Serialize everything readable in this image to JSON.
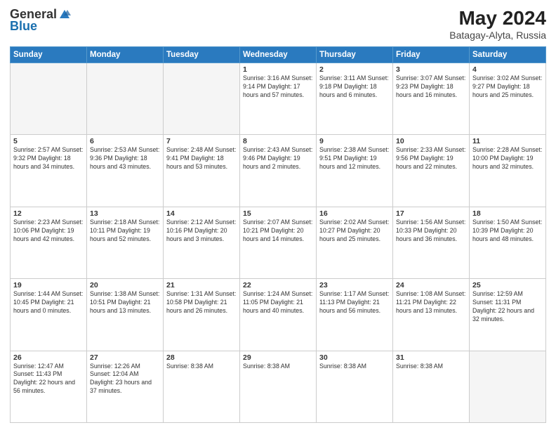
{
  "header": {
    "logo_general": "General",
    "logo_blue": "Blue",
    "month": "May 2024",
    "location": "Batagay-Alyta, Russia"
  },
  "weekdays": [
    "Sunday",
    "Monday",
    "Tuesday",
    "Wednesday",
    "Thursday",
    "Friday",
    "Saturday"
  ],
  "weeks": [
    [
      {
        "day": "",
        "info": ""
      },
      {
        "day": "",
        "info": ""
      },
      {
        "day": "",
        "info": ""
      },
      {
        "day": "1",
        "info": "Sunrise: 3:16 AM\nSunset: 9:14 PM\nDaylight: 17 hours and 57 minutes."
      },
      {
        "day": "2",
        "info": "Sunrise: 3:11 AM\nSunset: 9:18 PM\nDaylight: 18 hours and 6 minutes."
      },
      {
        "day": "3",
        "info": "Sunrise: 3:07 AM\nSunset: 9:23 PM\nDaylight: 18 hours and 16 minutes."
      },
      {
        "day": "4",
        "info": "Sunrise: 3:02 AM\nSunset: 9:27 PM\nDaylight: 18 hours and 25 minutes."
      }
    ],
    [
      {
        "day": "5",
        "info": "Sunrise: 2:57 AM\nSunset: 9:32 PM\nDaylight: 18 hours and 34 minutes."
      },
      {
        "day": "6",
        "info": "Sunrise: 2:53 AM\nSunset: 9:36 PM\nDaylight: 18 hours and 43 minutes."
      },
      {
        "day": "7",
        "info": "Sunrise: 2:48 AM\nSunset: 9:41 PM\nDaylight: 18 hours and 53 minutes."
      },
      {
        "day": "8",
        "info": "Sunrise: 2:43 AM\nSunset: 9:46 PM\nDaylight: 19 hours and 2 minutes."
      },
      {
        "day": "9",
        "info": "Sunrise: 2:38 AM\nSunset: 9:51 PM\nDaylight: 19 hours and 12 minutes."
      },
      {
        "day": "10",
        "info": "Sunrise: 2:33 AM\nSunset: 9:56 PM\nDaylight: 19 hours and 22 minutes."
      },
      {
        "day": "11",
        "info": "Sunrise: 2:28 AM\nSunset: 10:00 PM\nDaylight: 19 hours and 32 minutes."
      }
    ],
    [
      {
        "day": "12",
        "info": "Sunrise: 2:23 AM\nSunset: 10:06 PM\nDaylight: 19 hours and 42 minutes."
      },
      {
        "day": "13",
        "info": "Sunrise: 2:18 AM\nSunset: 10:11 PM\nDaylight: 19 hours and 52 minutes."
      },
      {
        "day": "14",
        "info": "Sunrise: 2:12 AM\nSunset: 10:16 PM\nDaylight: 20 hours and 3 minutes."
      },
      {
        "day": "15",
        "info": "Sunrise: 2:07 AM\nSunset: 10:21 PM\nDaylight: 20 hours and 14 minutes."
      },
      {
        "day": "16",
        "info": "Sunrise: 2:02 AM\nSunset: 10:27 PM\nDaylight: 20 hours and 25 minutes."
      },
      {
        "day": "17",
        "info": "Sunrise: 1:56 AM\nSunset: 10:33 PM\nDaylight: 20 hours and 36 minutes."
      },
      {
        "day": "18",
        "info": "Sunrise: 1:50 AM\nSunset: 10:39 PM\nDaylight: 20 hours and 48 minutes."
      }
    ],
    [
      {
        "day": "19",
        "info": "Sunrise: 1:44 AM\nSunset: 10:45 PM\nDaylight: 21 hours and 0 minutes."
      },
      {
        "day": "20",
        "info": "Sunrise: 1:38 AM\nSunset: 10:51 PM\nDaylight: 21 hours and 13 minutes."
      },
      {
        "day": "21",
        "info": "Sunrise: 1:31 AM\nSunset: 10:58 PM\nDaylight: 21 hours and 26 minutes."
      },
      {
        "day": "22",
        "info": "Sunrise: 1:24 AM\nSunset: 11:05 PM\nDaylight: 21 hours and 40 minutes."
      },
      {
        "day": "23",
        "info": "Sunrise: 1:17 AM\nSunset: 11:13 PM\nDaylight: 21 hours and 56 minutes."
      },
      {
        "day": "24",
        "info": "Sunrise: 1:08 AM\nSunset: 11:21 PM\nDaylight: 22 hours and 13 minutes."
      },
      {
        "day": "25",
        "info": "Sunrise: 12:59 AM\nSunset: 11:31 PM\nDaylight: 22 hours and 32 minutes."
      }
    ],
    [
      {
        "day": "26",
        "info": "Sunrise: 12:47 AM\nSunset: 11:43 PM\nDaylight: 22 hours and 56 minutes."
      },
      {
        "day": "27",
        "info": "Sunrise: 12:26 AM\nSunset: 12:04 AM\nDaylight: 23 hours and 37 minutes."
      },
      {
        "day": "28",
        "info": "Sunrise: 8:38 AM\n\n"
      },
      {
        "day": "29",
        "info": "Sunrise: 8:38 AM\n\n"
      },
      {
        "day": "30",
        "info": "Sunrise: 8:38 AM\n\n"
      },
      {
        "day": "31",
        "info": "Sunrise: 8:38 AM\n\n"
      },
      {
        "day": "",
        "info": ""
      }
    ]
  ]
}
